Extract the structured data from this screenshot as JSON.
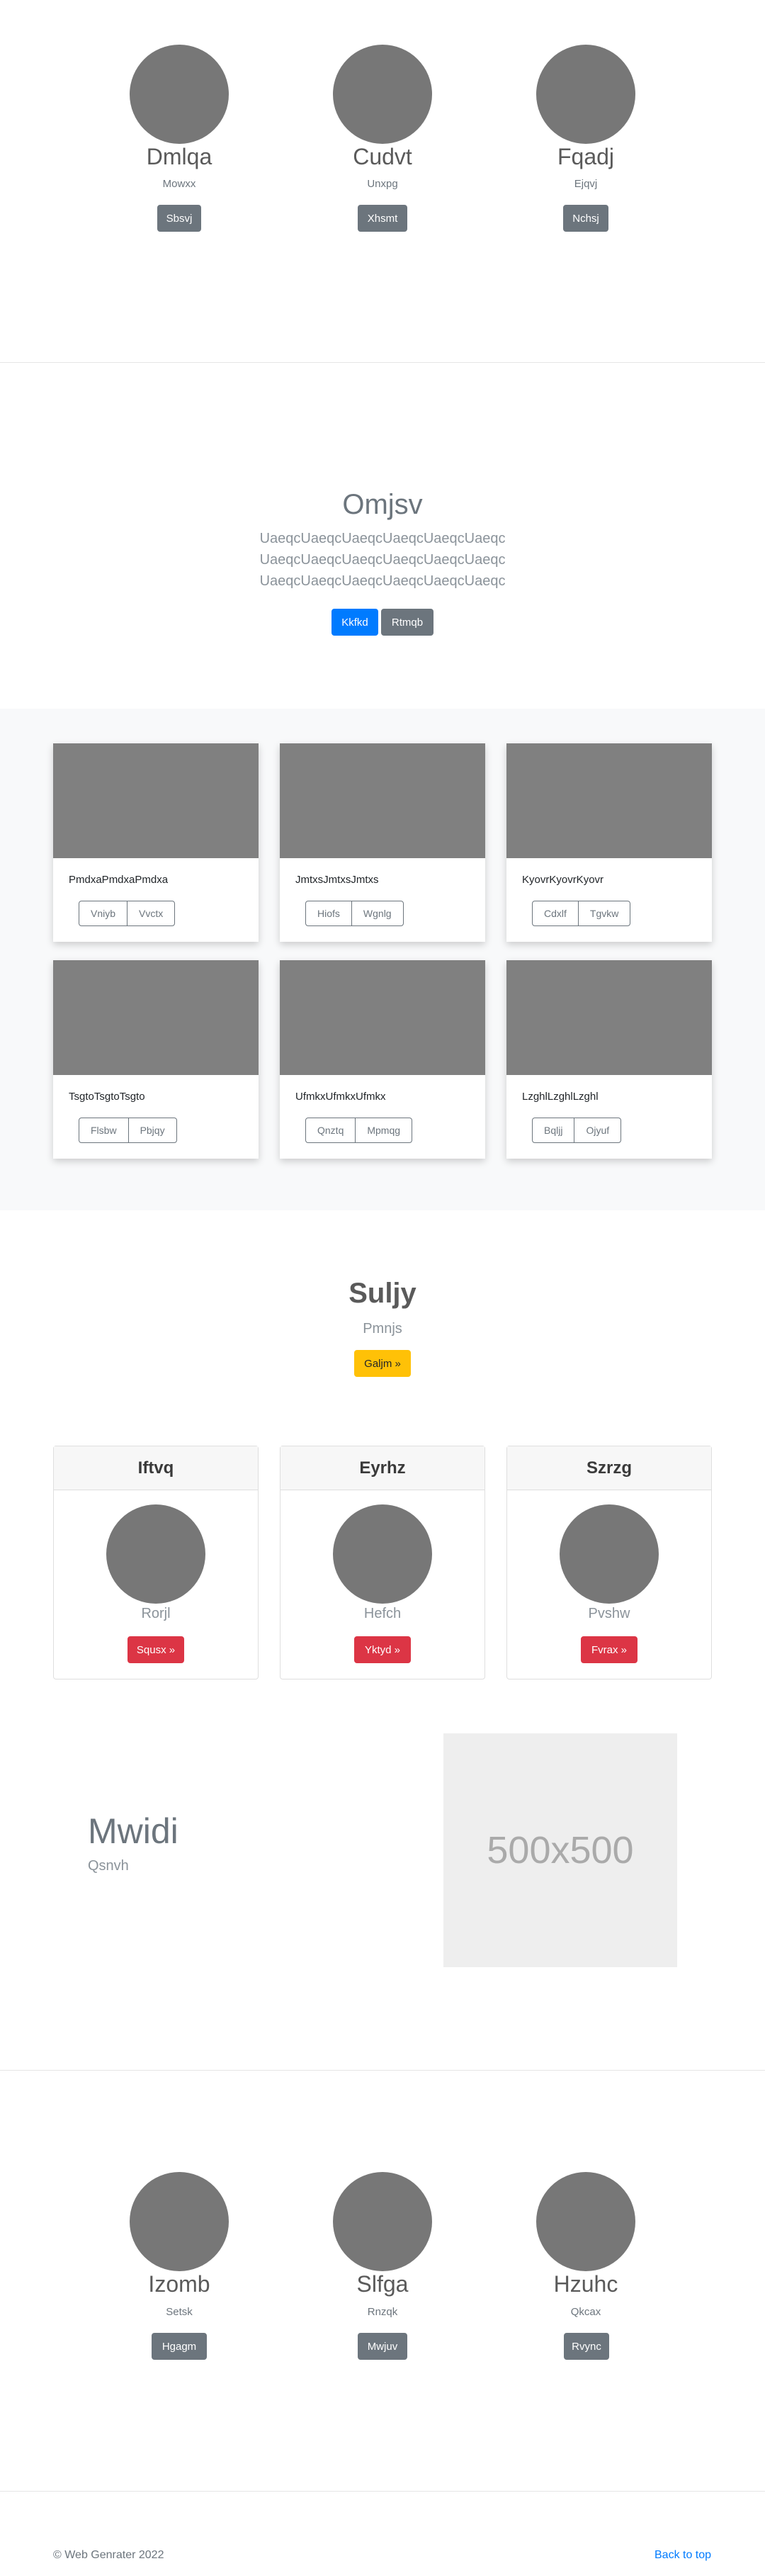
{
  "top_profiles": [
    {
      "name": "Dmlqa",
      "subtitle": "Mowxx",
      "button": "Sbsvj"
    },
    {
      "name": "Cudvt",
      "subtitle": "Unxpg",
      "button": "Xhsmt"
    },
    {
      "name": "Fqadj",
      "subtitle": "Ejqvj",
      "button": "Nchsj"
    }
  ],
  "jumbotron": {
    "title": "Omjsv",
    "lead_lines": [
      "UaeqcUaeqcUaeqcUaeqcUaeqcUaeqc",
      "UaeqcUaeqcUaeqcUaeqcUaeqcUaeqc",
      "UaeqcUaeqcUaeqcUaeqcUaeqcUaeqc"
    ],
    "primary_button": "Kkfkd",
    "secondary_button": "Rtmqb"
  },
  "album": [
    {
      "text": "PmdxaPmdxaPmdxa",
      "btn1": "Vniyb",
      "btn2": "Vvctx"
    },
    {
      "text": "JmtxsJmtxsJmtxs",
      "btn1": "Hiofs",
      "btn2": "Wgnlg"
    },
    {
      "text": "KyovrKyovrKyovr",
      "btn1": "Cdxlf",
      "btn2": "Tgvkw"
    },
    {
      "text": "TsgtoTsgtoTsgto",
      "btn1": "Flsbw",
      "btn2": "Pbjqy"
    },
    {
      "text": "UfmkxUfmkxUfmkx",
      "btn1": "Qnztq",
      "btn2": "Mpmqg"
    },
    {
      "text": "LzghlLzghlLzghl",
      "btn1": "Bqljj",
      "btn2": "Ojyuf"
    }
  ],
  "cta": {
    "title": "Suljy",
    "subtitle": "Pmnjs",
    "button": "Galjm »"
  },
  "feature_cards": [
    {
      "header": "Iftvq",
      "caption": "Rorjl",
      "button": "Squsx »"
    },
    {
      "header": "Eyrhz",
      "caption": "Hefch",
      "button": "Yktyd »"
    },
    {
      "header": "Szrzg",
      "caption": "Pvshw",
      "button": "Fvrax »"
    }
  ],
  "featurette": {
    "heading": "Mwidi",
    "subheading": "Qsnvh",
    "image_label": "500x500"
  },
  "bottom_profiles": [
    {
      "name": "Izomb",
      "subtitle": "Setsk",
      "button": "Hgagm"
    },
    {
      "name": "Slfga",
      "subtitle": "Rnzqk",
      "button": "Mwjuv"
    },
    {
      "name": "Hzuhc",
      "subtitle": "Qkcax",
      "button": "Rvync"
    }
  ],
  "footer": {
    "copyright": "© Web Genrater 2022",
    "back_to_top": "Back to top"
  },
  "colors": {
    "primary": "#007bff",
    "secondary": "#6c757d",
    "warning": "#ffc107",
    "danger": "#dc3545",
    "placeholder_gray": "#777777"
  }
}
